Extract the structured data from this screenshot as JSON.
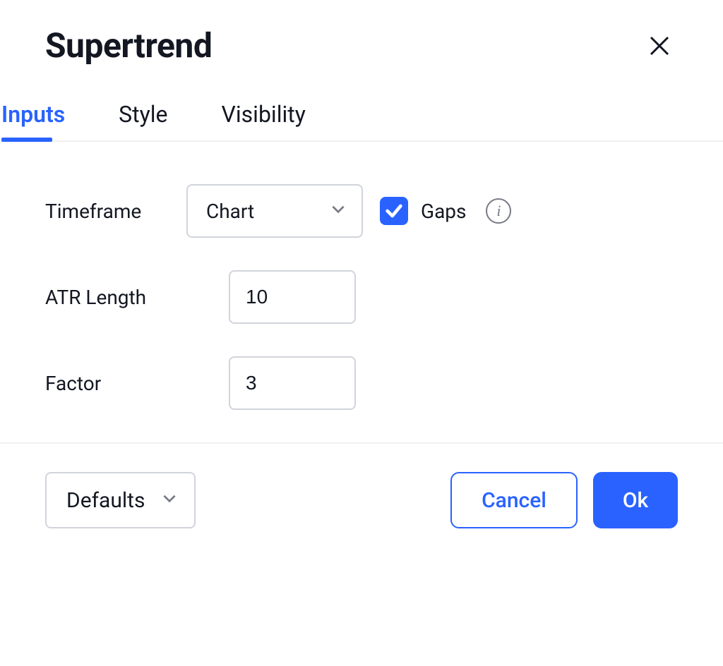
{
  "title": "Supertrend",
  "tabs": [
    {
      "label": "Inputs",
      "active": true
    },
    {
      "label": "Style",
      "active": false
    },
    {
      "label": "Visibility",
      "active": false
    }
  ],
  "fields": {
    "timeframe": {
      "label": "Timeframe",
      "value": "Chart"
    },
    "gaps": {
      "label": "Gaps",
      "checked": true
    },
    "atr_length": {
      "label": "ATR Length",
      "value": "10"
    },
    "factor": {
      "label": "Factor",
      "value": "3"
    }
  },
  "footer": {
    "defaults": "Defaults",
    "cancel": "Cancel",
    "ok": "Ok"
  },
  "colors": {
    "accent": "#2962ff"
  }
}
